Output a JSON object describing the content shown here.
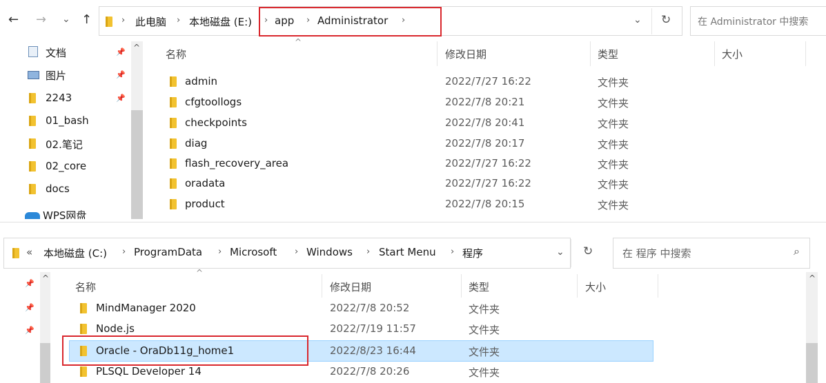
{
  "top": {
    "nav": {
      "back": "←",
      "forward": "→",
      "recent": "⌄",
      "up": "↑"
    },
    "breadcrumb": [
      "此电脑",
      "本地磁盘 (E:)",
      "app",
      "Administrator"
    ],
    "dropdown": "⌄",
    "refresh": "↻",
    "search_placeholder": "在 Administrator 中搜索",
    "quick_access": [
      {
        "label": "文档",
        "icon": "document-icon",
        "pinned": true
      },
      {
        "label": "图片",
        "icon": "pictures-icon",
        "pinned": true
      },
      {
        "label": "2243",
        "icon": "folder-icon",
        "pinned": true
      },
      {
        "label": "01_bash",
        "icon": "folder-icon",
        "pinned": false
      },
      {
        "label": "02.笔记",
        "icon": "folder-icon",
        "pinned": false
      },
      {
        "label": "02_core",
        "icon": "folder-icon",
        "pinned": false
      },
      {
        "label": "docs",
        "icon": "folder-icon",
        "pinned": false
      },
      {
        "label": "WPS网盘",
        "icon": "cloud-icon",
        "pinned": false
      }
    ],
    "columns": {
      "name": "名称",
      "date": "修改日期",
      "type": "类型",
      "size": "大小"
    },
    "rows": [
      {
        "name": "admin",
        "date": "2022/7/27 16:22",
        "type": "文件夹"
      },
      {
        "name": "cfgtoollogs",
        "date": "2022/7/8 20:21",
        "type": "文件夹"
      },
      {
        "name": "checkpoints",
        "date": "2022/7/8 20:41",
        "type": "文件夹"
      },
      {
        "name": "diag",
        "date": "2022/7/8 20:17",
        "type": "文件夹"
      },
      {
        "name": "flash_recovery_area",
        "date": "2022/7/27 16:22",
        "type": "文件夹"
      },
      {
        "name": "oradata",
        "date": "2022/7/27 16:22",
        "type": "文件夹"
      },
      {
        "name": "product",
        "date": "2022/7/8 20:15",
        "type": "文件夹"
      }
    ]
  },
  "bottom": {
    "overflow": "«",
    "breadcrumb": [
      "本地磁盘 (C:)",
      "ProgramData",
      "Microsoft",
      "Windows",
      "Start Menu",
      "程序"
    ],
    "dropdown": "⌄",
    "refresh": "↻",
    "search_placeholder": "在 程序 中搜索",
    "search_icon": "⌕",
    "columns": {
      "name": "名称",
      "date": "修改日期",
      "type": "类型",
      "size": "大小"
    },
    "rows": [
      {
        "name": "MindManager 2020",
        "date": "2022/7/8 20:52",
        "type": "文件夹"
      },
      {
        "name": "Node.js",
        "date": "2022/7/19 11:57",
        "type": "文件夹"
      },
      {
        "name": "Oracle - OraDb11g_home1",
        "date": "2022/8/23 16:44",
        "type": "文件夹",
        "selected": true
      },
      {
        "name": "PLSQL Developer 14",
        "date": "2022/7/8 20:26",
        "type": "文件夹"
      }
    ]
  },
  "colors": {
    "highlight": "#d9262c",
    "selection_bg": "#cce8ff",
    "selection_border": "#99d1ff",
    "folder": "#f2c230"
  }
}
